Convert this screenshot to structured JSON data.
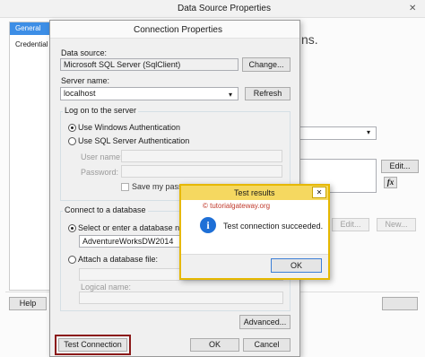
{
  "ds": {
    "title": "Data Source Properties",
    "close_glyph": "✕",
    "sidebar_items": [
      "General",
      "Credential"
    ],
    "heading_fragment": "ns.",
    "edit_label": "Edit...",
    "fx_label": "fx",
    "new_label": "New...",
    "help_label": "Help"
  },
  "cp": {
    "title": "Connection Properties",
    "datasource_label": "Data source:",
    "datasource_value": "Microsoft SQL Server (SqlClient)",
    "change_label": "Change...",
    "server_label": "Server name:",
    "server_value": "localhost",
    "refresh_label": "Refresh",
    "logon_group": "Log on to the server",
    "auth_windows": "Use Windows Authentication",
    "auth_sql": "Use SQL Server Authentication",
    "username_label": "User name:",
    "password_label": "Password:",
    "save_password": "Save my passwo",
    "connect_group": "Connect to a database",
    "select_db_label": "Select or enter a database name:",
    "db_value": "AdventureWorksDW2014",
    "attach_label": "Attach a database file:",
    "logical_label": "Logical name:",
    "advanced_label": "Advanced...",
    "test_label": "Test Connection",
    "ok_label": "OK",
    "cancel_label": "Cancel"
  },
  "tr": {
    "title": "Test results",
    "close_glyph": "✕",
    "watermark": "© tutorialgateway.org",
    "message": "Test connection succeeded.",
    "ok_label": "OK",
    "info_glyph": "i"
  },
  "colors": {
    "accent_border": "#e6b800",
    "test_highlight": "#8b1a1a",
    "info_blue": "#1e6fd6"
  }
}
